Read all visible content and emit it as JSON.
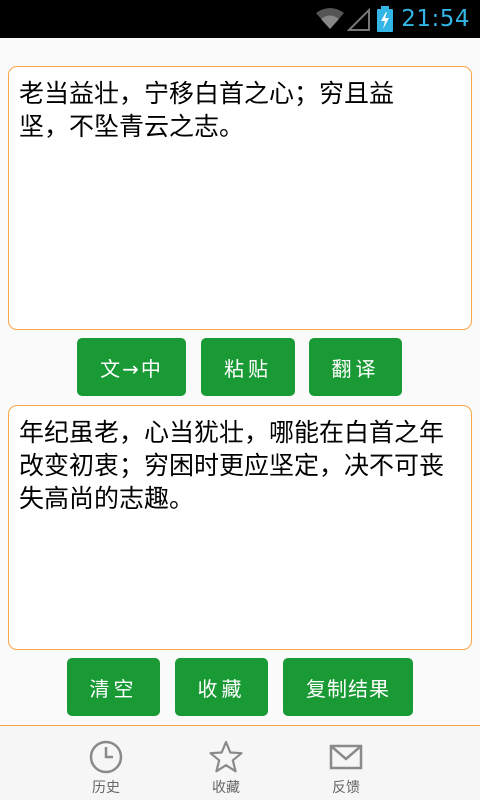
{
  "status_bar": {
    "time": "21:54",
    "icons": [
      "wifi-icon",
      "signal-icon",
      "battery-charging-icon"
    ],
    "accent_color": "#33b5e5"
  },
  "source": {
    "text": "老当益壮，宁移白首之心；穷且益坚，不坠青云之志。"
  },
  "actions_top": {
    "translate_mode_label": "文→中",
    "paste_label": "粘贴",
    "translate_label": "翻译"
  },
  "result": {
    "text": "年纪虽老，心当犹壮，哪能在白首之年改变初衷；穷困时更应坚定，决不可丧失高尚的志趣。"
  },
  "actions_bottom": {
    "clear_label": "清空",
    "favorite_label": "收藏",
    "copy_label": "复制结果"
  },
  "bottom_nav": {
    "items": [
      {
        "label": "历史",
        "icon": "clock-icon"
      },
      {
        "label": "收藏",
        "icon": "star-icon"
      },
      {
        "label": "反馈",
        "icon": "envelope-icon"
      }
    ]
  },
  "colors": {
    "button_green": "#1a9a35",
    "border_orange": "#f4a640",
    "background": "#fafafa"
  }
}
